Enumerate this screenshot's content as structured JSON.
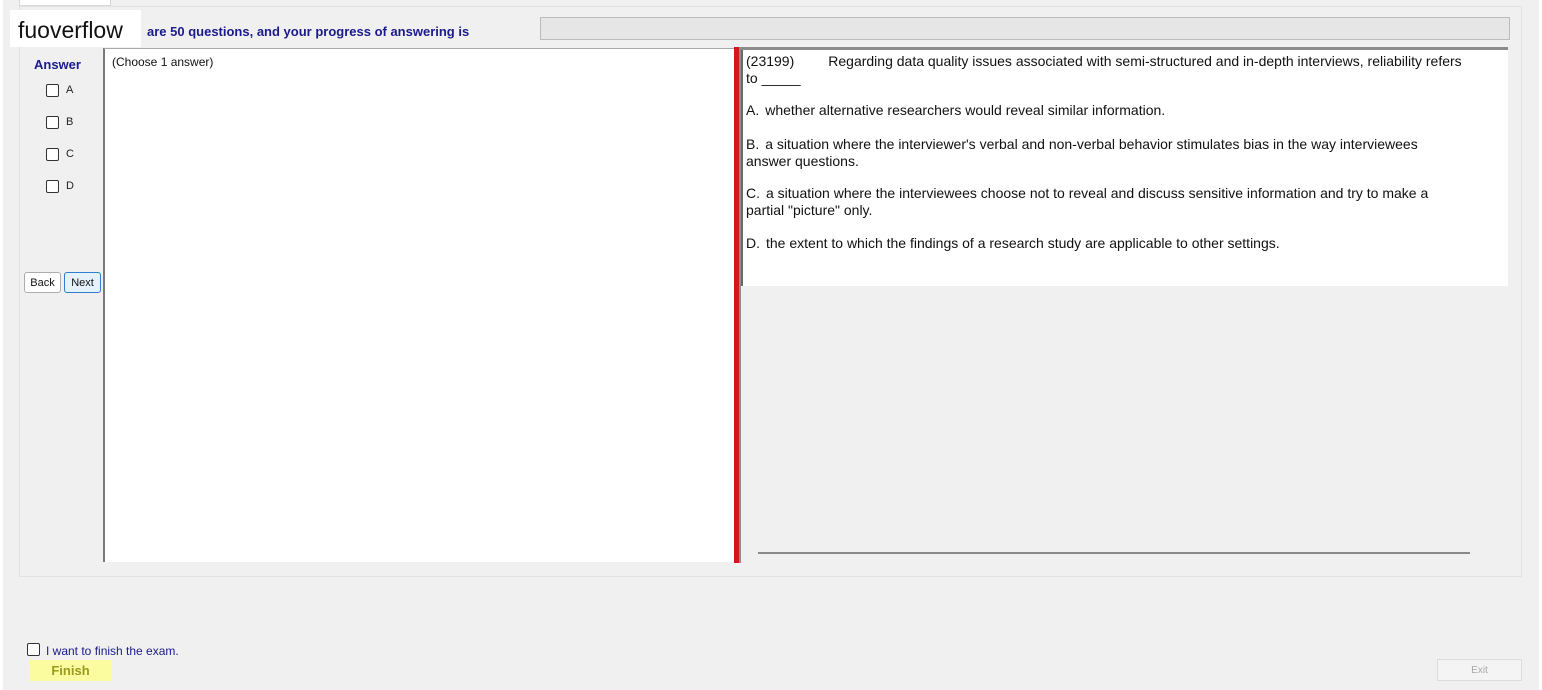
{
  "header": {
    "watermark": "fuoverflow",
    "progress_text": "are 50 questions, and your progress of answering is",
    "progress_fraction": 0.0
  },
  "answer_panel": {
    "title": "Answer",
    "options": [
      {
        "label": "A",
        "checked": false
      },
      {
        "label": "B",
        "checked": false
      },
      {
        "label": "C",
        "checked": false
      },
      {
        "label": "D",
        "checked": false
      }
    ],
    "back_label": "Back",
    "next_label": "Next"
  },
  "left_box": {
    "hint": "(Choose 1 answer)"
  },
  "question": {
    "id": "(23199)",
    "stem": "Regarding data quality issues associated with semi-structured and in-depth interviews, reliability refers to _____",
    "options": [
      {
        "letter": "A.",
        "text": "whether alternative researchers would reveal similar information."
      },
      {
        "letter": "B.",
        "text": "a situation where the interviewer's verbal and non-verbal behavior stimulates bias in the way interviewees answer questions."
      },
      {
        "letter": "C.",
        "text": "a situation where the interviewees choose not to reveal and discuss sensitive information and try to make a partial \"picture\" only."
      },
      {
        "letter": "D.",
        "text": "the extent to which the findings of a research study are applicable to other settings."
      }
    ]
  },
  "footer": {
    "finish_checkbox_label": "I want to finish the exam.",
    "finish_label": "Finish",
    "exit_label": "Exit"
  },
  "colors": {
    "accent_text": "#1a1a8c",
    "splitter": "#d21818",
    "finish_bg": "#fbfba0"
  }
}
